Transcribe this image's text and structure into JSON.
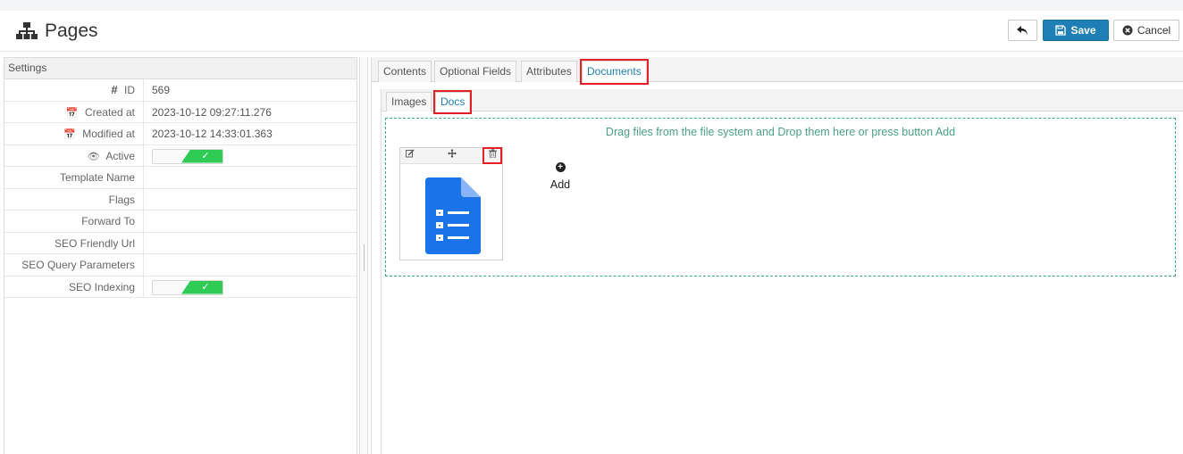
{
  "header": {
    "title": "Pages",
    "icon": "sitemap-icon",
    "save_label": "Save",
    "cancel_label": "Cancel"
  },
  "settings": {
    "title": "Settings",
    "rows": [
      {
        "label": "ID",
        "icon": "#",
        "value": "569"
      },
      {
        "label": "Created at",
        "icon": "calendar-icon",
        "value": "2023-10-12 09:27:11.276"
      },
      {
        "label": "Modified at",
        "icon": "calendar-icon",
        "value": "2023-10-12 14:33:01.363"
      },
      {
        "label": "Active",
        "icon": "eye-icon",
        "value": ""
      },
      {
        "label": "Template Name",
        "value": ""
      },
      {
        "label": "Flags",
        "value": ""
      },
      {
        "label": "Forward To",
        "value": ""
      },
      {
        "label": "SEO Friendly Url",
        "value": ""
      },
      {
        "label": "SEO Query Parameters",
        "value": ""
      },
      {
        "label": "SEO Indexing",
        "value": ""
      }
    ],
    "active_toggle": {
      "on": true,
      "check": "✓"
    },
    "seo_toggle": {
      "on": true,
      "check": "✓"
    }
  },
  "tabs": [
    "Contents",
    "Optional Fields",
    "Attributes",
    "Documents"
  ],
  "active_tab": "Documents",
  "subtabs": [
    "Images",
    "Docs"
  ],
  "active_subtab": "Docs",
  "dropzone": {
    "message": "Drag files from the file system and Drop them here or press button Add",
    "add_label": "Add"
  },
  "colors": {
    "accent": "#1e7fb4",
    "highlight": "#e41f26",
    "toggle_on": "#2ecc55",
    "drop_border": "#3aa88e",
    "doc_icon": "#1a73e8"
  }
}
